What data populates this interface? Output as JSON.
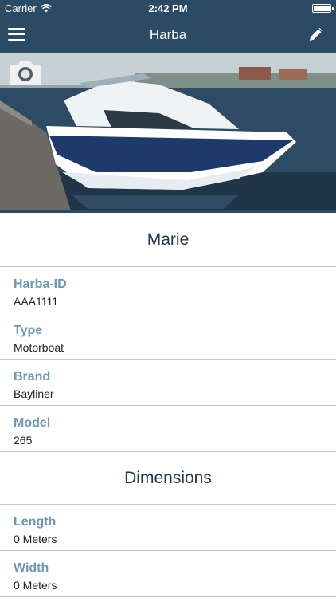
{
  "status_bar": {
    "carrier": "Carrier",
    "time": "2:42 PM"
  },
  "nav_bar": {
    "title": "Harba"
  },
  "boat": {
    "name": "Marie"
  },
  "details": [
    {
      "label": "Harba-ID",
      "value": "AAA1111"
    },
    {
      "label": "Type",
      "value": "Motorboat"
    },
    {
      "label": "Brand",
      "value": "Bayliner"
    },
    {
      "label": "Model",
      "value": "265"
    }
  ],
  "dimensions": {
    "title": "Dimensions",
    "items": [
      {
        "label": "Length",
        "value": "0 Meters"
      },
      {
        "label": "Width",
        "value": "0 Meters"
      }
    ]
  },
  "colors": {
    "header_bg": "#2b4a63",
    "label": "#6c97b8",
    "divider": "#b7c7d2"
  }
}
